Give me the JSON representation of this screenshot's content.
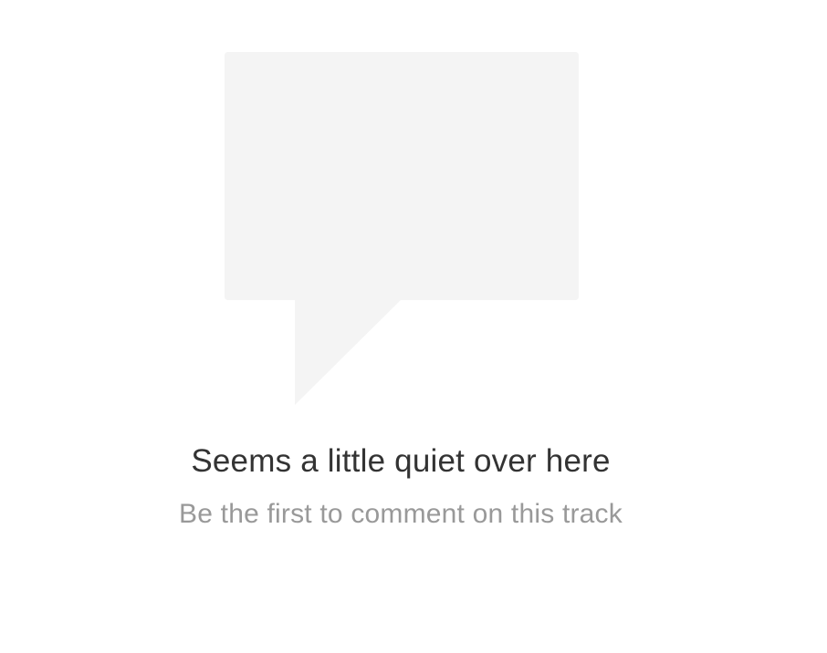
{
  "empty_state": {
    "icon": "speech-bubble-icon",
    "title": "Seems a little quiet over here",
    "subtitle": "Be the first to comment on this track"
  },
  "colors": {
    "background": "#ffffff",
    "bubble": "#f4f4f4",
    "title": "#333333",
    "subtitle": "#999999"
  }
}
